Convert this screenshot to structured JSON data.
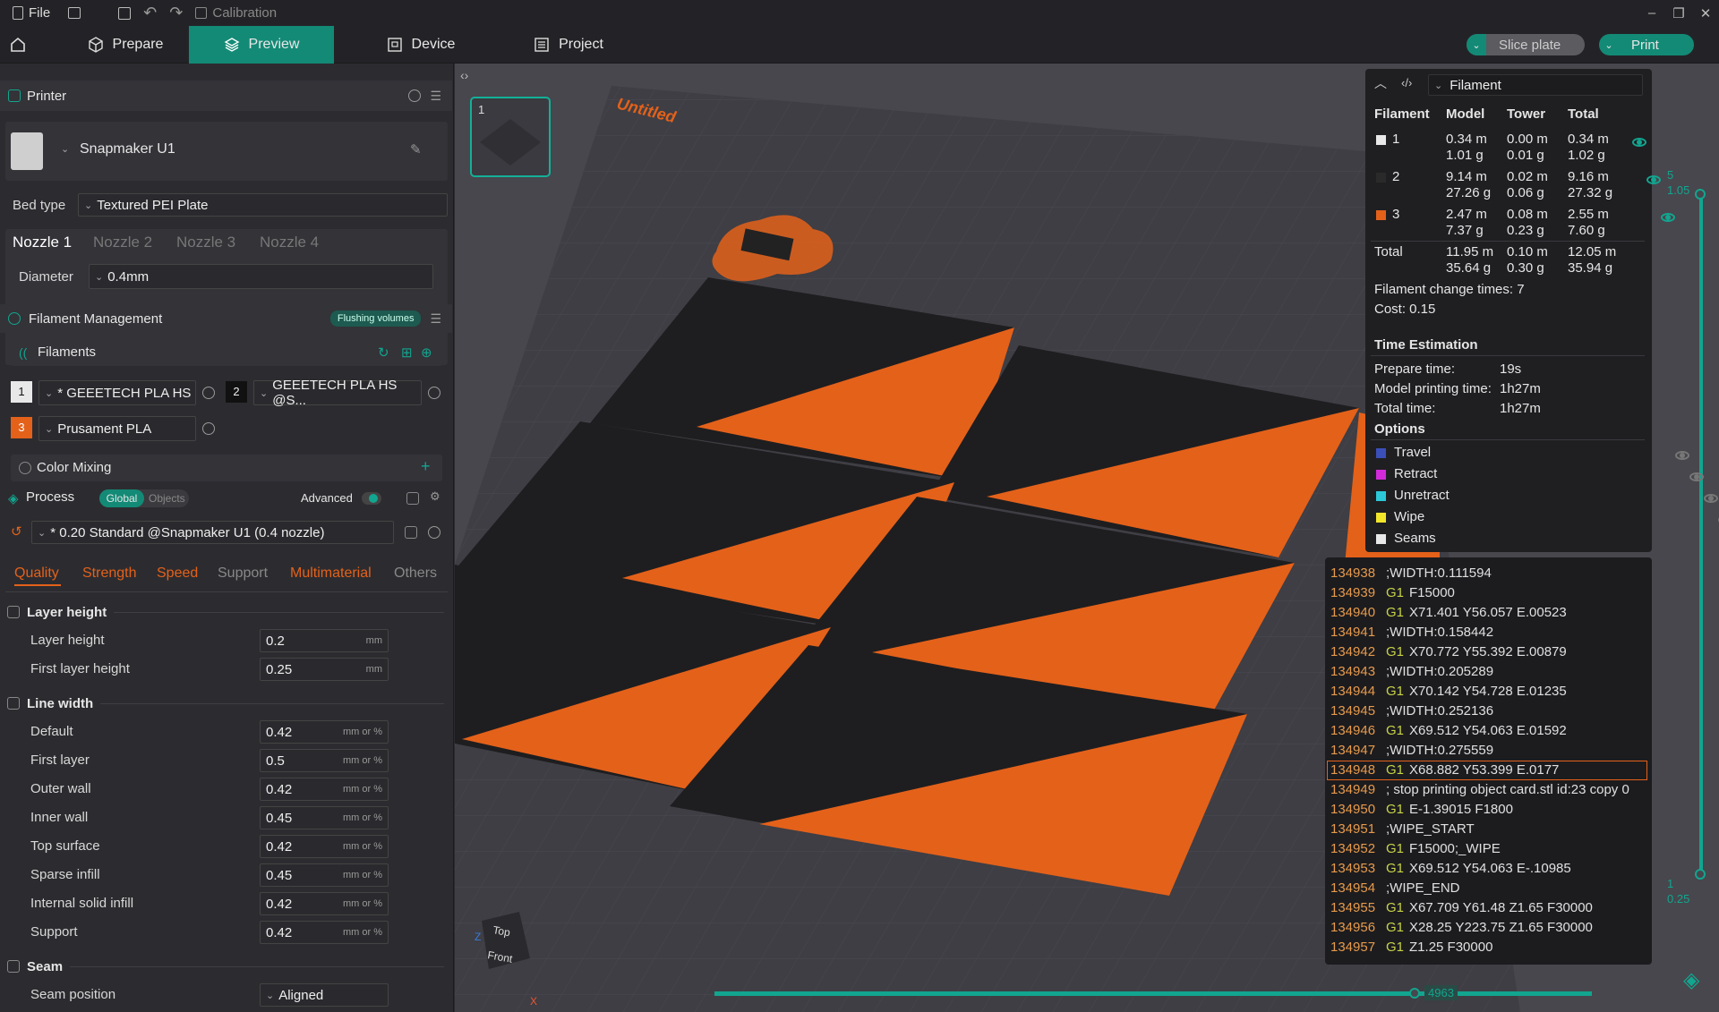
{
  "titlebar": {
    "file": "File",
    "calibration": "Calibration"
  },
  "nav": {
    "prepare": "Prepare",
    "preview": "Preview",
    "device": "Device",
    "project": "Project",
    "slice_plate": "Slice plate",
    "print": "Print"
  },
  "printer": {
    "section_title": "Printer",
    "name": "Snapmaker U1",
    "bed_type_label": "Bed type",
    "bed_type_value": "Textured PEI Plate",
    "nozzle_tabs": [
      "Nozzle 1",
      "Nozzle 2",
      "Nozzle 3",
      "Nozzle 4"
    ],
    "diameter_label": "Diameter",
    "diameter_value": "0.4mm"
  },
  "filament_mgmt": {
    "title": "Filament Management",
    "flushing_button": "Flushing volumes",
    "filaments_label": "Filaments",
    "slots": [
      {
        "index": "1",
        "name": "* GEEETECH PLA HS",
        "color": "#e8e8e8"
      },
      {
        "index": "2",
        "name": "GEEETECH PLA HS @S...",
        "color": "#111111"
      },
      {
        "index": "3",
        "name": "Prusament PLA",
        "color": "#e4611a"
      }
    ],
    "color_mixing": "Color Mixing"
  },
  "process": {
    "title": "Process",
    "global": "Global",
    "objects": "Objects",
    "advanced": "Advanced",
    "preset": "* 0.20 Standard @Snapmaker U1 (0.4 nozzle)",
    "tabs": [
      "Quality",
      "Strength",
      "Speed",
      "Support",
      "Multimaterial",
      "Others"
    ],
    "groups": [
      {
        "title": "Layer height",
        "rows": [
          {
            "label": "Layer height",
            "value": "0.2",
            "unit": "mm"
          },
          {
            "label": "First layer height",
            "value": "0.25",
            "unit": "mm"
          }
        ]
      },
      {
        "title": "Line width",
        "rows": [
          {
            "label": "Default",
            "value": "0.42",
            "unit": "mm or %"
          },
          {
            "label": "First layer",
            "value": "0.5",
            "unit": "mm or %"
          },
          {
            "label": "Outer wall",
            "value": "0.42",
            "unit": "mm or %"
          },
          {
            "label": "Inner wall",
            "value": "0.45",
            "unit": "mm or %"
          },
          {
            "label": "Top surface",
            "value": "0.42",
            "unit": "mm or %"
          },
          {
            "label": "Sparse infill",
            "value": "0.45",
            "unit": "mm or %"
          },
          {
            "label": "Internal solid infill",
            "value": "0.42",
            "unit": "mm or %"
          },
          {
            "label": "Support",
            "value": "0.42",
            "unit": "mm or %"
          }
        ]
      },
      {
        "title": "Seam",
        "rows": [
          {
            "label": "Seam position",
            "value": "Aligned",
            "unit": ""
          }
        ]
      }
    ]
  },
  "viewport": {
    "plate_name": "Untitled",
    "plate_number": "1",
    "nav_cube_top": "Top",
    "nav_cube_front": "Front",
    "layer_top": "5",
    "layer_top_z": "1.05",
    "layer_bottom": "1",
    "layer_bottom_z": "0.25",
    "move_count": "4963"
  },
  "legend": {
    "view_type": "Filament",
    "headers": [
      "Filament",
      "Model",
      "Tower",
      "Total"
    ],
    "rows": [
      {
        "id": "1",
        "color": "#e8e8e8",
        "model_m": "0.34 m",
        "model_g": "1.01 g",
        "tower_m": "0.00 m",
        "tower_g": "0.01 g",
        "total_m": "0.34 m",
        "total_g": "1.02 g"
      },
      {
        "id": "2",
        "color": "#2a2a2a",
        "model_m": "9.14 m",
        "model_g": "27.26 g",
        "tower_m": "0.02 m",
        "tower_g": "0.06 g",
        "total_m": "9.16 m",
        "total_g": "27.32 g"
      },
      {
        "id": "3",
        "color": "#e4611a",
        "model_m": "2.47 m",
        "model_g": "7.37 g",
        "tower_m": "0.08 m",
        "tower_g": "0.23 g",
        "total_m": "2.55 m",
        "total_g": "7.60 g"
      }
    ],
    "total": {
      "label": "Total",
      "model_m": "11.95 m",
      "model_g": "35.64 g",
      "tower_m": "0.10 m",
      "tower_g": "0.30 g",
      "total_m": "12.05 m",
      "total_g": "35.94 g"
    },
    "change_times": "Filament change times:  7",
    "cost": "Cost:  0.15",
    "time_title": "Time Estimation",
    "prepare_label": "Prepare time:",
    "prepare_value": "19s",
    "model_label": "Model printing time:",
    "model_value": "1h27m",
    "total_label": "Total time:",
    "total_value": "1h27m",
    "options_title": "Options",
    "options": [
      {
        "name": "Travel",
        "color": "#3b4fb8",
        "visible": false
      },
      {
        "name": "Retract",
        "color": "#d22ad8",
        "visible": false
      },
      {
        "name": "Unretract",
        "color": "#2cc8d8",
        "visible": false
      },
      {
        "name": "Wipe",
        "color": "#f2e62a",
        "visible": false
      },
      {
        "name": "Seams",
        "color": "#e8e8e8",
        "visible": true
      }
    ]
  },
  "gcode": [
    {
      "n": "134938",
      "cmd": "",
      "rest": ";WIDTH:0.111594"
    },
    {
      "n": "134939",
      "cmd": "G1",
      "rest": "F15000"
    },
    {
      "n": "134940",
      "cmd": "G1",
      "rest": "X71.401 Y56.057 E.00523"
    },
    {
      "n": "134941",
      "cmd": "",
      "rest": ";WIDTH:0.158442"
    },
    {
      "n": "134942",
      "cmd": "G1",
      "rest": "X70.772 Y55.392 E.00879"
    },
    {
      "n": "134943",
      "cmd": "",
      "rest": ";WIDTH:0.205289"
    },
    {
      "n": "134944",
      "cmd": "G1",
      "rest": "X70.142 Y54.728 E.01235"
    },
    {
      "n": "134945",
      "cmd": "",
      "rest": ";WIDTH:0.252136"
    },
    {
      "n": "134946",
      "cmd": "G1",
      "rest": "X69.512 Y54.063 E.01592"
    },
    {
      "n": "134947",
      "cmd": "",
      "rest": ";WIDTH:0.275559"
    },
    {
      "n": "134948",
      "cmd": "G1",
      "rest": "X68.882 Y53.399 E.0177"
    },
    {
      "n": "134949",
      "cmd": "",
      "rest": "; stop printing object card.stl id:23 copy 0"
    },
    {
      "n": "134950",
      "cmd": "G1",
      "rest": "E-1.39015 F1800"
    },
    {
      "n": "134951",
      "cmd": "",
      "rest": ";WIPE_START"
    },
    {
      "n": "134952",
      "cmd": "G1",
      "rest": "F15000;_WIPE"
    },
    {
      "n": "134953",
      "cmd": "G1",
      "rest": "X69.512 Y54.063 E-.10985"
    },
    {
      "n": "134954",
      "cmd": "",
      "rest": ";WIPE_END"
    },
    {
      "n": "134955",
      "cmd": "G1",
      "rest": "X67.709 Y61.48 Z1.65 F30000"
    },
    {
      "n": "134956",
      "cmd": "G1",
      "rest": "X28.25 Y223.75 Z1.65 F30000"
    },
    {
      "n": "134957",
      "cmd": "G1",
      "rest": "Z1.25 F30000"
    }
  ],
  "colors": {
    "accent": "#138a76",
    "orange": "#e4611a",
    "dark_tile": "#1e1e20"
  }
}
